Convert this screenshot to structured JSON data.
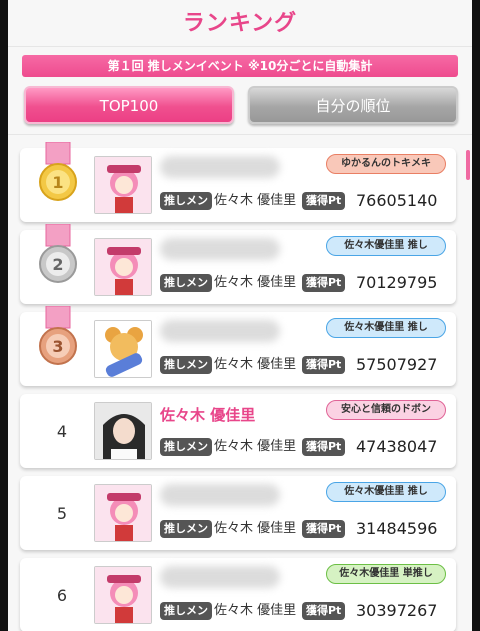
{
  "header": {
    "title": "ランキング"
  },
  "event_banner": "第１回 推しメンイベント ※10分ごとに自動集計",
  "tabs": [
    {
      "label": "TOP100",
      "active": true
    },
    {
      "label": "自分の順位",
      "active": false
    }
  ],
  "labels": {
    "oshi_tag": "推しメン",
    "points_tag": "獲得Pt"
  },
  "rows": [
    {
      "rank": "1",
      "medal": "gold-medal",
      "nickname": "",
      "badge": "ゆかるんのトキメキ",
      "badge_color": "orange",
      "oshi": "佐々木 優佳里",
      "points": "76605140"
    },
    {
      "rank": "2",
      "medal": "silver-medal",
      "nickname": "",
      "badge": "佐々木優佳里 推し",
      "badge_color": "blue",
      "oshi": "佐々木 優佳里",
      "points": "70129795"
    },
    {
      "rank": "3",
      "medal": "bronze-medal",
      "nickname": "",
      "badge": "佐々木優佳里 推し",
      "badge_color": "blue",
      "oshi": "佐々木 優佳里",
      "points": "57507927"
    },
    {
      "rank": "4",
      "medal": "",
      "nickname": "佐々木 優佳里",
      "badge": "安心と信頼のドボン",
      "badge_color": "pink",
      "oshi": "佐々木 優佳里",
      "points": "47438047"
    },
    {
      "rank": "5",
      "medal": "",
      "nickname": "",
      "badge": "佐々木優佳里 推し",
      "badge_color": "blue",
      "oshi": "佐々木 優佳里",
      "points": "31484596"
    },
    {
      "rank": "6",
      "medal": "",
      "nickname": "",
      "badge": "佐々木優佳里 単推し",
      "badge_color": "green",
      "oshi": "佐々木 優佳里",
      "points": "30397267"
    }
  ],
  "colors": {
    "accent": "#e8468a",
    "gold": "#f3c845",
    "silver": "#c8c8c8",
    "bronze": "#e7a17e"
  }
}
